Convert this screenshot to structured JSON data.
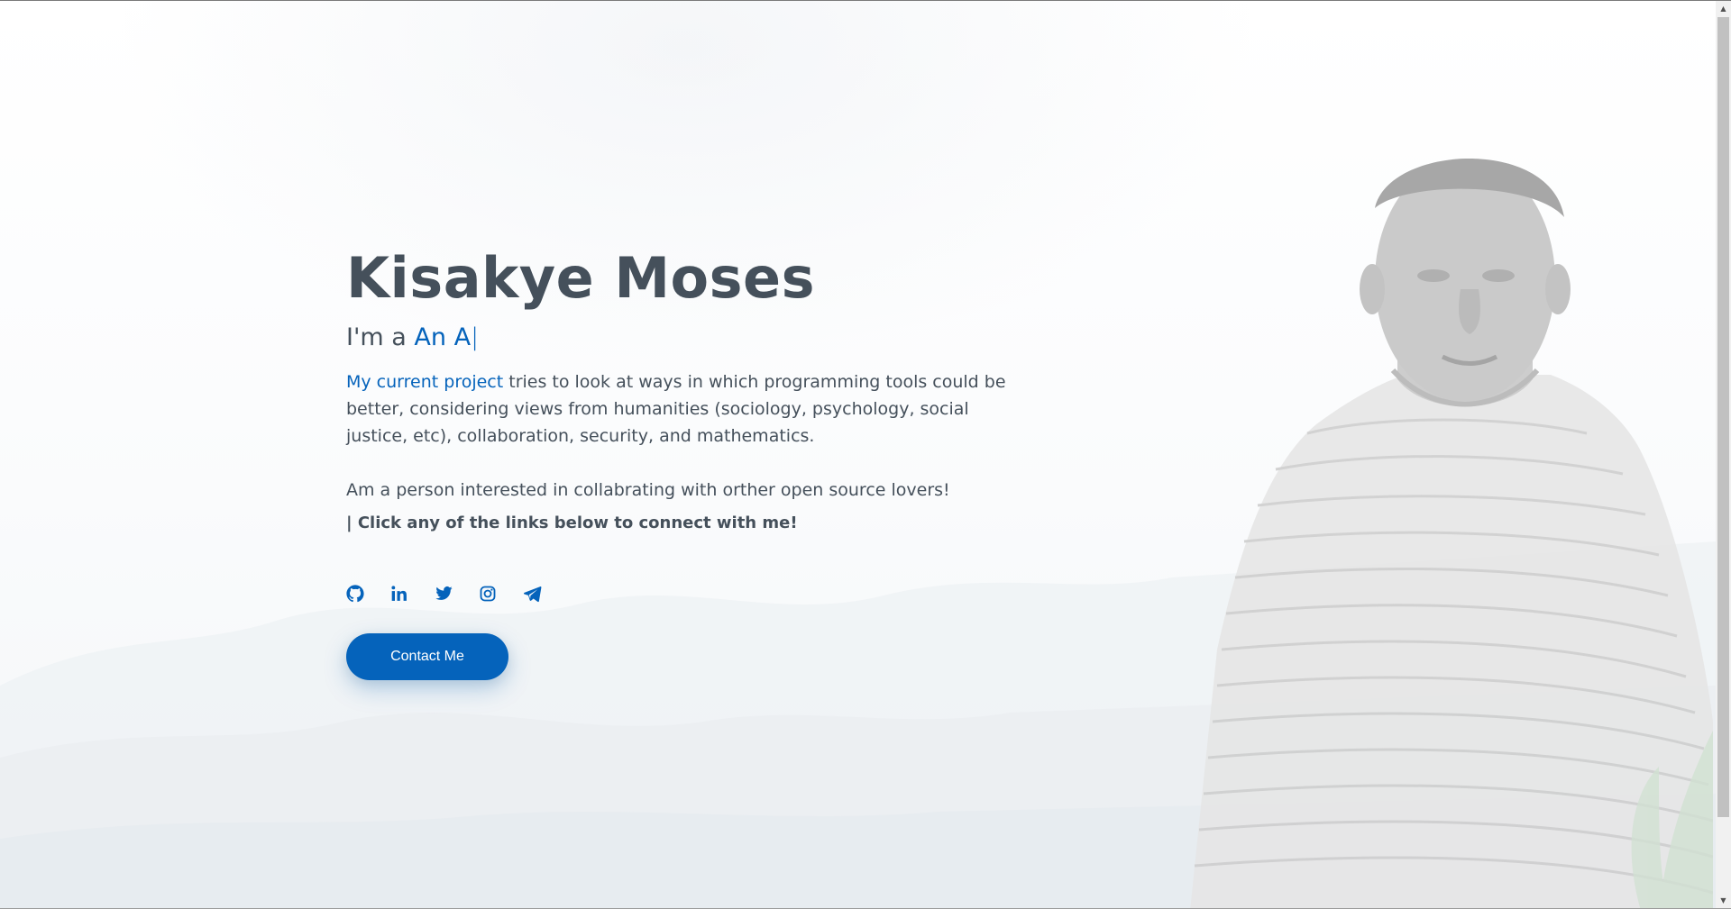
{
  "hero": {
    "name": "Kisakye Moses",
    "typed_prefix": "I'm a ",
    "typed_text": "An A",
    "cursor": "|",
    "project_link": "My current project",
    "description_rest": " tries to look at ways in which programming tools could be better, considering views from humanities (sociology, psychology, social justice, etc), collaboration, security, and mathematics.",
    "interest": "Am a person interested in collabrating with orther open source lovers!",
    "cta": "| Click any of the links below to connect with me!",
    "contact_button": "Contact Me"
  },
  "social_links": [
    {
      "icon": "github-icon"
    },
    {
      "icon": "linkedin-icon"
    },
    {
      "icon": "twitter-icon"
    },
    {
      "icon": "instagram-icon"
    },
    {
      "icon": "telegram-icon"
    }
  ],
  "colors": {
    "accent": "#0563bb",
    "text": "#45505b",
    "background": "#ffffff"
  },
  "scrollbar": {
    "up_arrow": "▲",
    "down_arrow": "▼"
  }
}
